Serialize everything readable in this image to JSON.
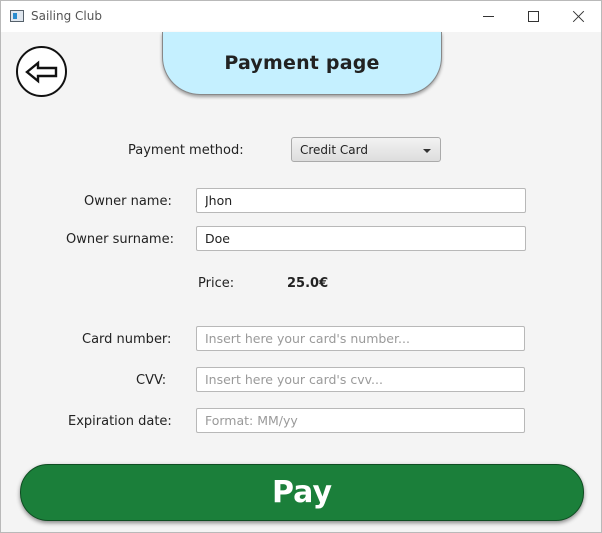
{
  "window": {
    "title": "Sailing Club"
  },
  "header": {
    "title": "Payment page"
  },
  "form": {
    "payment_method_label": "Payment method:",
    "payment_method_value": "Credit Card",
    "owner_name_label": "Owner name:",
    "owner_name_value": "Jhon",
    "owner_surname_label": "Owner surname:",
    "owner_surname_value": "Doe",
    "price_label": "Price:",
    "price_value": "25.0€",
    "card_number_label": "Card number:",
    "card_number_placeholder": "Insert here your card's number...",
    "cvv_label": "CVV:",
    "cvv_placeholder": "Insert here your card's cvv...",
    "expiration_label": "Expiration date:",
    "expiration_placeholder": "Format: MM/yy"
  },
  "actions": {
    "pay_label": "Pay"
  },
  "icons": {
    "back": "left-arrow-icon",
    "app": "app-window-icon"
  },
  "colors": {
    "header_bg": "#c5f0ff",
    "pay_bg": "#1b7f3a",
    "window_bg": "#f4f4f4"
  }
}
